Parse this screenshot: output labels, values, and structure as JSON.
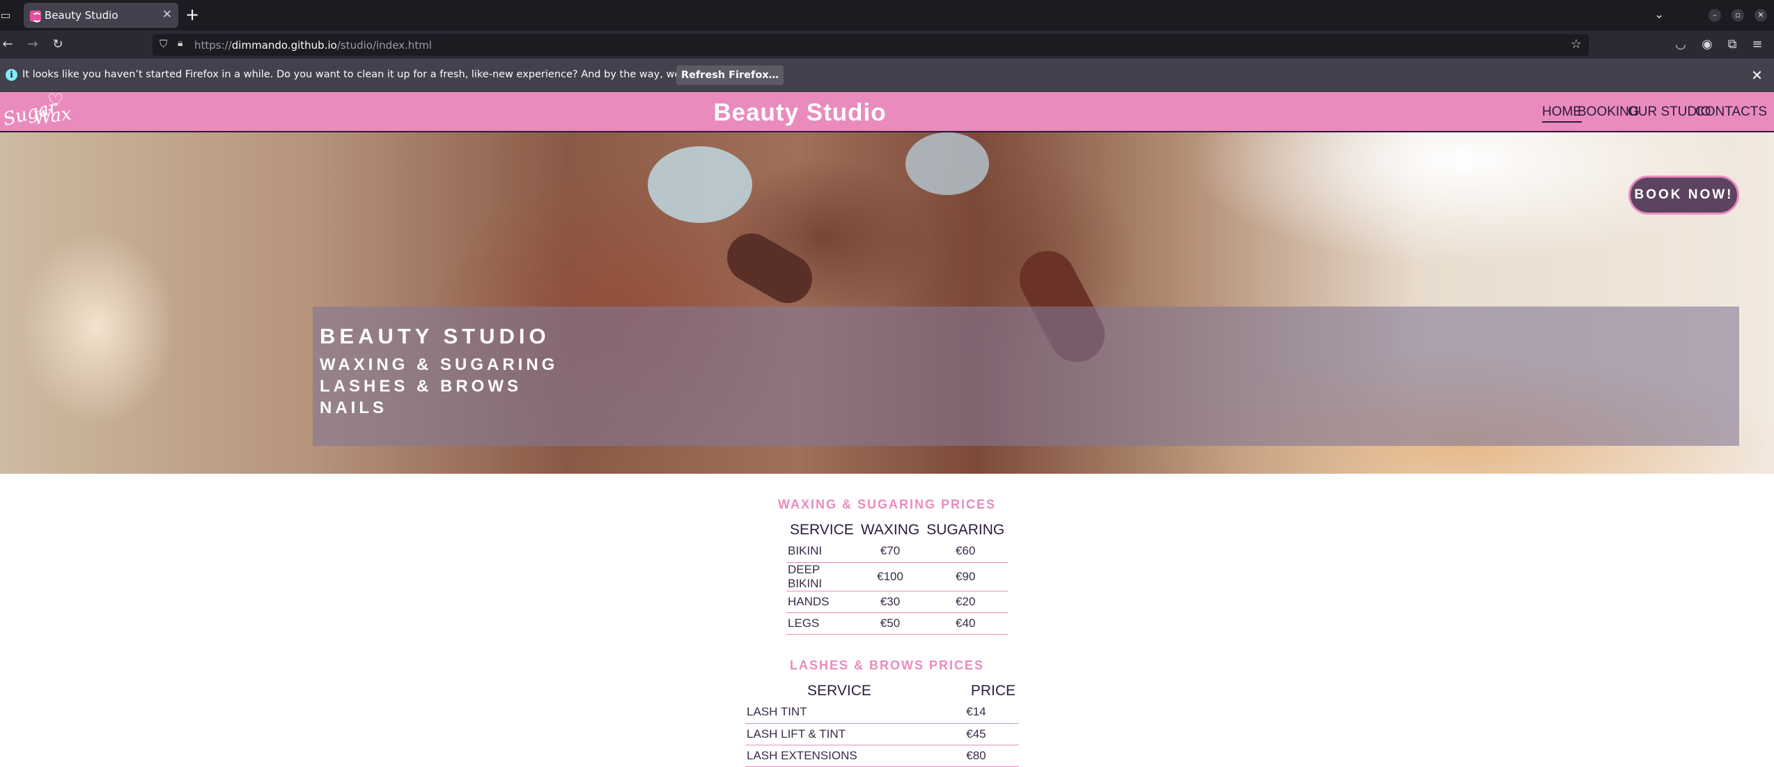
{
  "browser": {
    "tab_title": "Beauty Studio",
    "url_prefix": "https://",
    "url_host": "dimmando.github.io",
    "url_path": "/studio/index.html",
    "infobar_text": "It looks like you haven’t started Firefox in a while. Do you want to clean it up for a fresh, like-new experience? And by the way, welcome back!",
    "infobar_button": "Refresh Firefox…"
  },
  "header": {
    "logo_line1": "Sugar",
    "logo_line2": "Wax",
    "title": "Beauty Studio",
    "menu": [
      {
        "label": "HOME",
        "active": true
      },
      {
        "label": "BOOKING",
        "active": false
      },
      {
        "label": "OUR STUDIO",
        "active": false
      },
      {
        "label": "CONTACTS",
        "active": false
      }
    ]
  },
  "hero": {
    "book_button": "BOOK NOW!",
    "line1": "BEAUTY STUDIO",
    "line2": "WAXING & SUGARING",
    "line3": "LASHES & BROWS",
    "line4": "NAILS"
  },
  "waxing": {
    "title": "WAXING & SUGARING PRICES",
    "headers": [
      "SERVICE",
      "WAXING",
      "SUGARING"
    ],
    "rows": [
      [
        "BIKINI",
        "€70",
        "€60"
      ],
      [
        "DEEP BIKINI",
        "€100",
        "€90"
      ],
      [
        "HANDS",
        "€30",
        "€20"
      ],
      [
        "LEGS",
        "€50",
        "€40"
      ]
    ]
  },
  "lashes": {
    "title": "LASHES & BROWS PRICES",
    "headers": [
      "SERVICE",
      "PRICE"
    ],
    "rows": [
      [
        "LASH TINT",
        "€14"
      ],
      [
        "LASH LIFT & TINT",
        "€45"
      ],
      [
        "LASH EXTENSIONS",
        "€80"
      ]
    ]
  },
  "colors": {
    "accent_pink": "#e98bbd",
    "dark_purple": "#2d1b3d",
    "button_bg": "#5c4461"
  }
}
